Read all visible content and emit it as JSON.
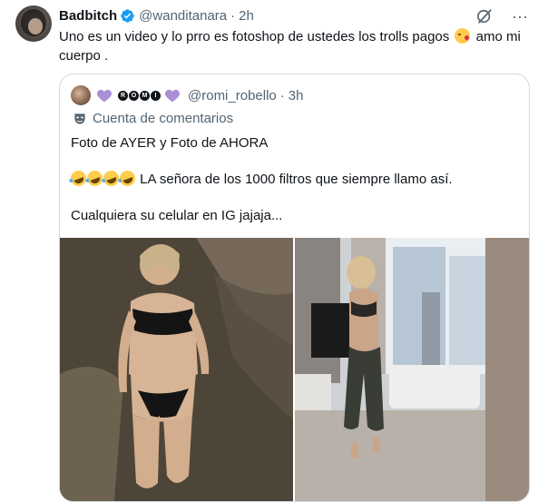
{
  "tweet": {
    "display_name": "Badbitch",
    "handle": "@wanditanara",
    "separator": "·",
    "time": "2h",
    "text_before_emoji": "Uno es un video y lo prro es fotoshop de ustedes los trolls pagos",
    "text_after_emoji": "amo mi cuerpo .",
    "emoji": "kissing-face"
  },
  "quoted": {
    "display_name_letters": [
      "R",
      "O",
      "M",
      "I"
    ],
    "handle": "@romi_robello",
    "separator": "·",
    "time": "3h",
    "account_label": "Cuenta de comentarios",
    "lines": [
      "Foto de AYER  y Foto de AHORA",
      "LA señora de los 1000 filtros que siempre llamo así.",
      "Cualquiera su celular en IG jajaja..."
    ],
    "laugh_emoji_count": 4
  },
  "icons": {
    "verified": "verified-badge-icon",
    "grok": "grok-icon",
    "more": "more-icon",
    "heart": "purple-heart-icon",
    "mask": "mask-icon"
  },
  "colors": {
    "verified_blue": "#1d9bf0",
    "secondary_text": "#536471",
    "heart_purple": "#aa8ed6",
    "border": "#cfd9de"
  }
}
